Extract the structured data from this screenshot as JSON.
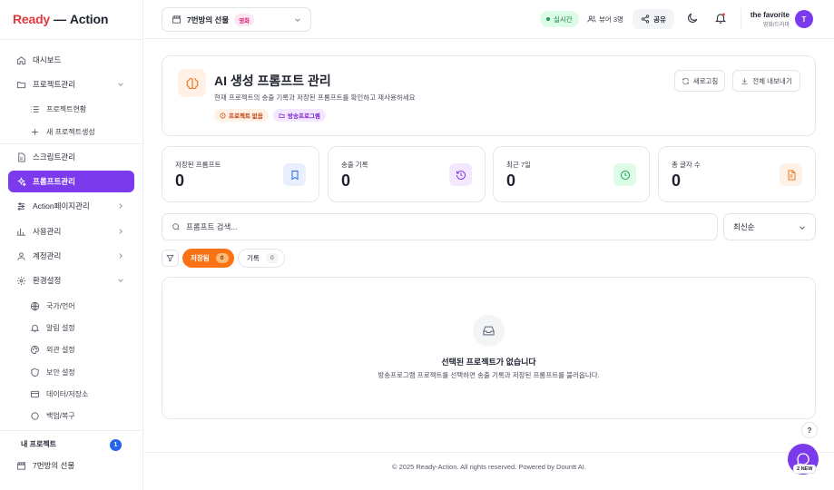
{
  "brand": {
    "part1": "Ready",
    "dash": "—",
    "part2": "Action",
    "part1_color": "#e0393e"
  },
  "sidebar": {
    "items": [
      {
        "label": "대시보드",
        "icon": "home-icon"
      },
      {
        "label": "프로젝트관리",
        "icon": "folder-icon",
        "expanded": true
      },
      {
        "label": "프로젝트현황",
        "icon": "list-icon",
        "sub": true
      },
      {
        "label": "새 프로젝트생성",
        "icon": "plus-icon",
        "sub": true
      },
      {
        "label": "스크립트관리",
        "icon": "document-icon"
      },
      {
        "label": "프롬프트관리",
        "icon": "sparkle-icon",
        "active": true
      },
      {
        "label": "Action페이지관리",
        "icon": "sliders-icon"
      },
      {
        "label": "사용관리",
        "icon": "chart-icon"
      },
      {
        "label": "계정관리",
        "icon": "user-icon"
      },
      {
        "label": "환경설정",
        "icon": "gear-icon",
        "expanded": true
      },
      {
        "label": "국가/언어",
        "icon": "globe-icon",
        "sub": true
      },
      {
        "label": "알림 설정",
        "icon": "bell-icon",
        "sub": true
      },
      {
        "label": "외관 설정",
        "icon": "palette-icon",
        "sub": true
      },
      {
        "label": "보안 설정",
        "icon": "shield-icon",
        "sub": true
      },
      {
        "label": "데이터/저장소",
        "icon": "database-icon",
        "sub": true
      },
      {
        "label": "백업/복구",
        "icon": "backup-icon",
        "sub": true
      }
    ],
    "my_projects": {
      "title": "내 프로젝트",
      "count": "1",
      "items": [
        {
          "label": "7번방의 선물",
          "icon": "clapper-icon"
        }
      ]
    }
  },
  "topbar": {
    "project": {
      "name": "7번방의 선물",
      "genre": "영화"
    },
    "live": "실시간",
    "viewers": "뷰어 3명",
    "share": "공유",
    "user": {
      "name": "the favorite",
      "role": "영화/드라마",
      "initial": "T"
    }
  },
  "hero": {
    "title": "AI 생성 프롬프트 관리",
    "subtitle": "현재 프로젝트의 송출 기록과 저장된 프롬프트를 확인하고 재사용하세요",
    "tags": [
      "프로젝트 없음",
      "방송프로그램"
    ],
    "refresh": "새로고침",
    "export": "전체 내보내기"
  },
  "stats": [
    {
      "label": "저장된 프롬프트",
      "value": "0",
      "color": "#2563eb",
      "bg": "#e8f0fe",
      "icon": "bookmark-icon"
    },
    {
      "label": "송출 기록",
      "value": "0",
      "color": "#7c3aed",
      "bg": "#f3e8ff",
      "icon": "history-icon"
    },
    {
      "label": "최근 7일",
      "value": "0",
      "color": "#16a34a",
      "bg": "#dcfce7",
      "icon": "clock-icon"
    },
    {
      "label": "총 글자 수",
      "value": "0",
      "color": "#ea7a2a",
      "bg": "#fff1e6",
      "icon": "file-icon"
    }
  ],
  "search": {
    "placeholder": "프롬프트 검색..."
  },
  "sort": {
    "selected": "최신순"
  },
  "tabs": [
    {
      "label": "저장됨",
      "count": "0",
      "active": true
    },
    {
      "label": "기록",
      "count": "0",
      "active": false
    }
  ],
  "empty": {
    "title": "선택된 프로젝트가 없습니다",
    "subtitle": "방송프로그램 프로젝트를 선택하면 송출 기록과 저장된 프롬프트를 불러옵니다."
  },
  "footer": "© 2025 Ready-Action. All rights reserved. Powered by Dountt AI.",
  "help": "?",
  "chat_badge": "2 NEW",
  "accent": "#7c3aed"
}
